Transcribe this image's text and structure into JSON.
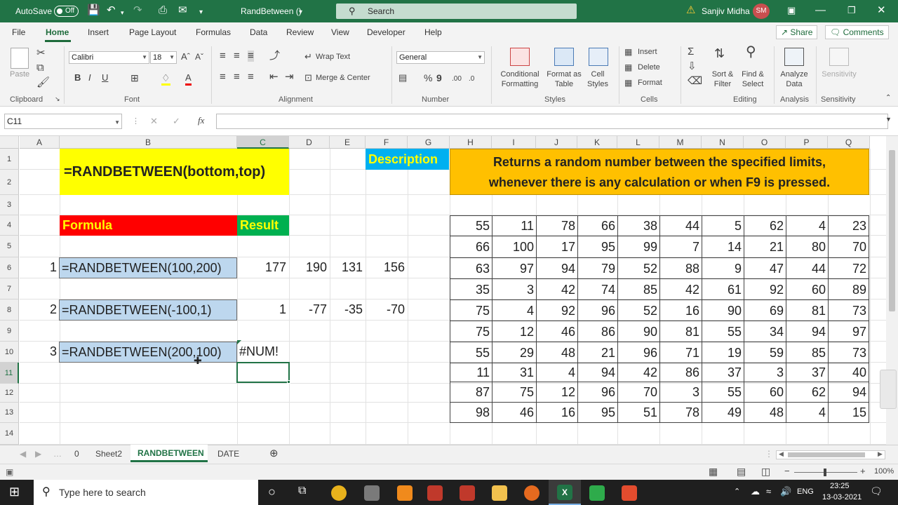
{
  "titlebar": {
    "autosave_label": "AutoSave",
    "autosave_state": "Off",
    "doc_title": "RandBetween ()",
    "search_placeholder": "Search",
    "user_name": "Sanjiv Midha",
    "user_initials": "SM"
  },
  "ribbon_tabs": [
    "File",
    "Home",
    "Insert",
    "Page Layout",
    "Formulas",
    "Data",
    "Review",
    "View",
    "Developer",
    "Help"
  ],
  "share_label": "Share",
  "comments_label": "Comments",
  "clipboard": {
    "paste": "Paste",
    "group": "Clipboard"
  },
  "font": {
    "name": "Calibri",
    "size": "18",
    "group": "Font"
  },
  "alignment": {
    "wrap": "Wrap Text",
    "merge": "Merge & Center",
    "group": "Alignment"
  },
  "number": {
    "format": "General",
    "group": "Number"
  },
  "styles": {
    "conditional": "Conditional Formatting",
    "format_table": "Format as Table",
    "cell_styles": "Cell Styles",
    "group": "Styles"
  },
  "cells": {
    "insert": "Insert",
    "delete": "Delete",
    "format": "Format",
    "group": "Cells"
  },
  "editing": {
    "sort": "Sort & Filter",
    "find": "Find & Select",
    "group": "Editing"
  },
  "analysis": {
    "analyze": "Analyze Data",
    "group": "Analysis"
  },
  "sensitivity": {
    "label": "Sensitivity",
    "group": "Sensitivity"
  },
  "formula_bar": {
    "name_box": "C11",
    "fx": "fx",
    "value": ""
  },
  "columns": [
    "A",
    "B",
    "C",
    "D",
    "E",
    "F",
    "G",
    "H",
    "I",
    "J",
    "K",
    "L",
    "M",
    "N",
    "O",
    "P",
    "Q"
  ],
  "rows": [
    "1",
    "2",
    "3",
    "4",
    "5",
    "6",
    "7",
    "8",
    "9",
    "10",
    "11",
    "12",
    "13",
    "14"
  ],
  "sheet": {
    "syntax": "=RANDBETWEEN(bottom,top)",
    "description_label": "Description",
    "description_text_line1": "Returns a random number between the specified limits,",
    "description_text_line2": "whenever there is any calculation or when F9 is pressed.",
    "formula_header": "Formula",
    "result_header": "Result",
    "examples": [
      {
        "index": "1",
        "formula": "=RANDBETWEEN(100,200)",
        "results": [
          "177",
          "190",
          "131",
          "156"
        ]
      },
      {
        "index": "2",
        "formula": "=RANDBETWEEN(-100,1)",
        "results": [
          "1",
          "-77",
          "-35",
          "-70"
        ]
      },
      {
        "index": "3",
        "formula": "=RANDBETWEEN(200,100)",
        "results": [
          "#NUM!"
        ]
      }
    ],
    "random_table": [
      [
        "55",
        "11",
        "78",
        "66",
        "38",
        "44",
        "5",
        "62",
        "4",
        "23"
      ],
      [
        "66",
        "100",
        "17",
        "95",
        "99",
        "7",
        "14",
        "21",
        "80",
        "70"
      ],
      [
        "63",
        "97",
        "94",
        "79",
        "52",
        "88",
        "9",
        "47",
        "44",
        "72"
      ],
      [
        "35",
        "3",
        "42",
        "74",
        "85",
        "42",
        "61",
        "92",
        "60",
        "89"
      ],
      [
        "75",
        "4",
        "92",
        "96",
        "52",
        "16",
        "90",
        "69",
        "81",
        "73"
      ],
      [
        "75",
        "12",
        "46",
        "86",
        "90",
        "81",
        "55",
        "34",
        "94",
        "97"
      ],
      [
        "55",
        "29",
        "48",
        "21",
        "96",
        "71",
        "19",
        "59",
        "85",
        "73"
      ],
      [
        "11",
        "31",
        "4",
        "94",
        "42",
        "86",
        "37",
        "3",
        "37",
        "40"
      ],
      [
        "87",
        "75",
        "12",
        "96",
        "70",
        "3",
        "55",
        "60",
        "62",
        "94"
      ],
      [
        "98",
        "46",
        "16",
        "95",
        "51",
        "78",
        "49",
        "48",
        "4",
        "15"
      ]
    ]
  },
  "sheet_tabs": [
    "0",
    "Sheet2",
    "RANDBETWEEN",
    "DATE"
  ],
  "active_sheet": "RANDBETWEEN",
  "status": {
    "zoom": "100%"
  },
  "taskbar": {
    "search_placeholder": "Type here to search",
    "lang": "ENG",
    "time": "23:25",
    "date": "13-03-2021"
  },
  "colors": {
    "excel_green": "#217346",
    "yellow": "#ffff00",
    "red": "#ff0000",
    "green": "#00b050",
    "orange": "#ffc000",
    "cyan": "#00b0f0",
    "formula_fill": "#bdd7ee"
  }
}
